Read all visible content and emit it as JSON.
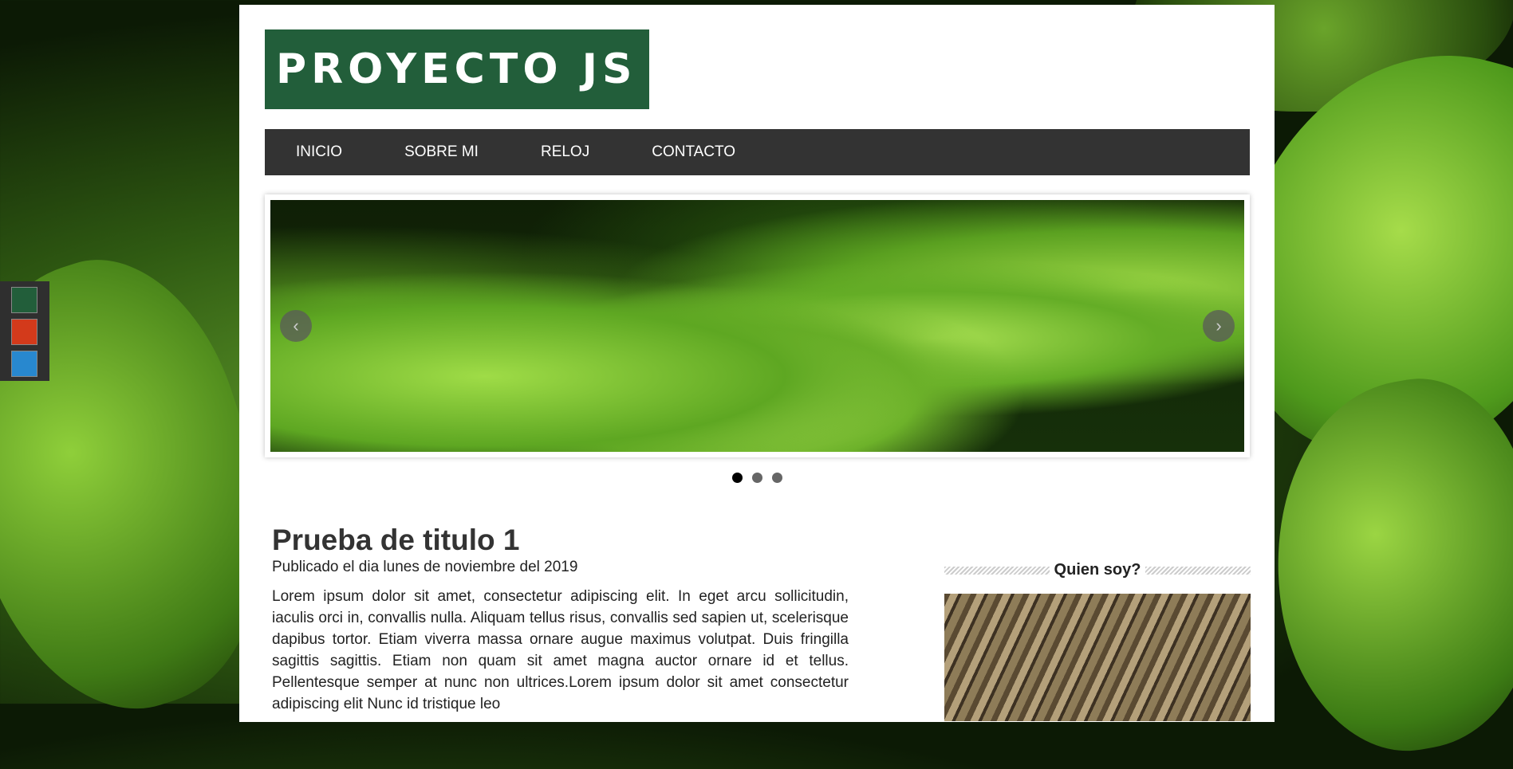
{
  "theme": {
    "swatches": [
      {
        "name": "green",
        "color": "#225e3a"
      },
      {
        "name": "red",
        "color": "#d33a1b"
      },
      {
        "name": "blue",
        "color": "#2888cf"
      }
    ]
  },
  "header": {
    "logo_text": "PROYECTO JS"
  },
  "nav": {
    "items": [
      "INICIO",
      "SOBRE MI",
      "RELOJ",
      "CONTACTO"
    ]
  },
  "slider": {
    "prev_arrow": "‹",
    "next_arrow": "›",
    "active_index": 0,
    "dot_count": 3
  },
  "article": {
    "title": "Prueba de titulo 1",
    "date": "Publicado el dia lunes de noviembre del 2019",
    "body": "Lorem ipsum dolor sit amet, consectetur adipiscing elit. In eget arcu sollicitudin, iaculis orci in, convallis nulla. Aliquam tellus risus, convallis sed sapien ut, scelerisque dapibus tortor. Etiam viverra massa ornare augue maximus volutpat. Duis fringilla sagittis sagittis. Etiam non quam sit amet magna auctor ornare id et tellus. Pellentesque semper at nunc non ultrices.Lorem ipsum dolor sit amet consectetur adipiscing elit Nunc id tristique leo"
  },
  "sidebar": {
    "heading": "Quien soy?"
  },
  "colors": {
    "accent": "#225e3a",
    "nav_bg": "#333333"
  }
}
